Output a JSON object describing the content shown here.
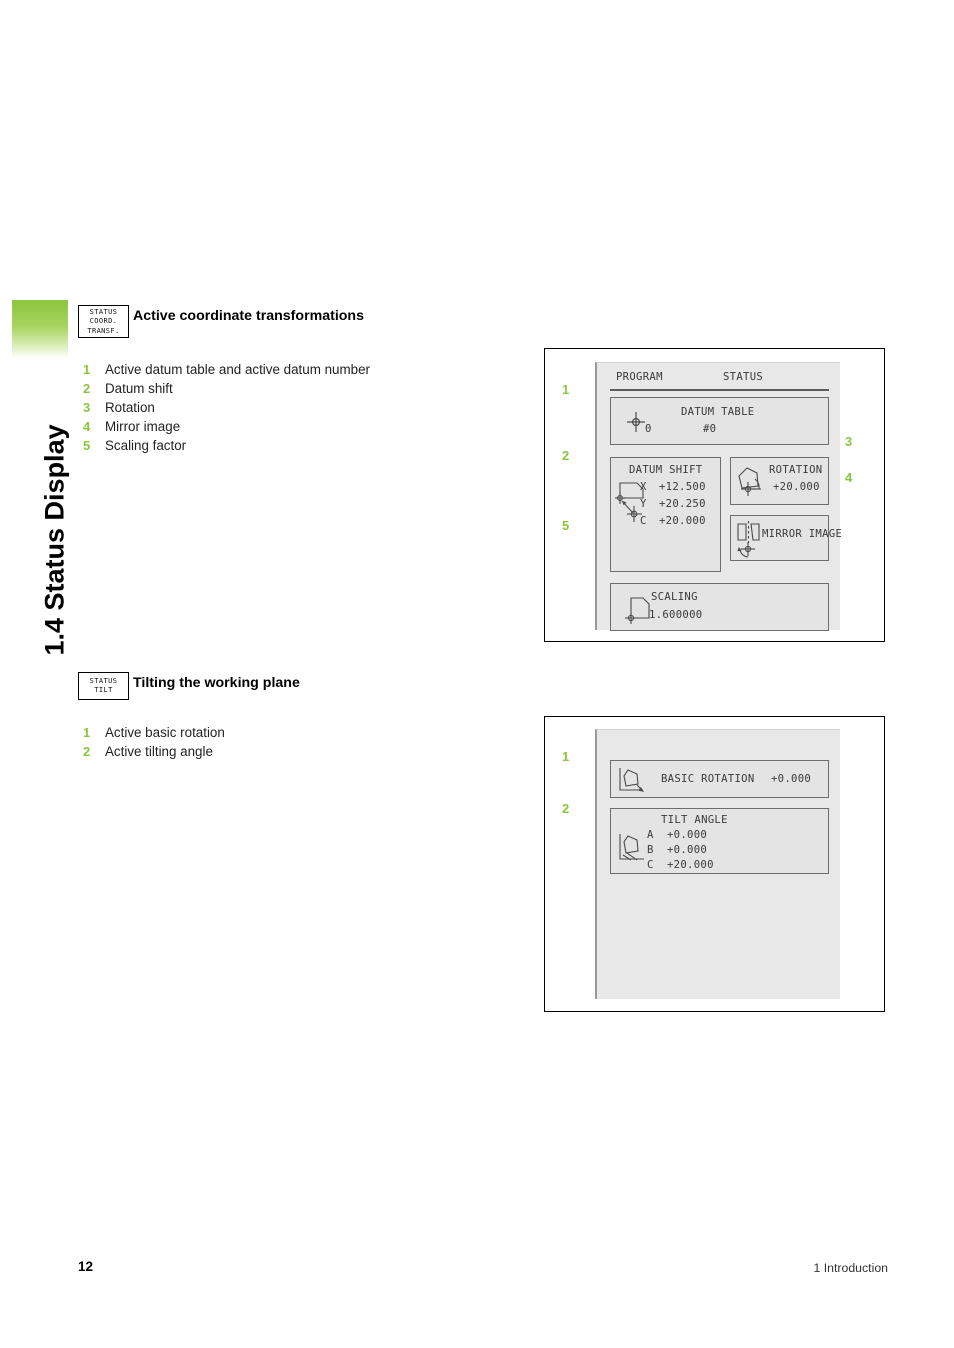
{
  "chapter": {
    "title": "1.4 Status Display",
    "accent_color": "#8CC63E"
  },
  "sections": [
    {
      "softkey": {
        "line1": "STATUS",
        "line2": "COORD.",
        "line3": "TRANSF."
      },
      "heading": "Active coordinate transformations",
      "legend": [
        {
          "num": "1",
          "label": "Active datum table and active datum number"
        },
        {
          "num": "2",
          "label": "Datum shift"
        },
        {
          "num": "3",
          "label": "Rotation"
        },
        {
          "num": "4",
          "label": "Mirror image"
        },
        {
          "num": "5",
          "label": "Scaling factor"
        }
      ]
    },
    {
      "softkey": {
        "line1": "STATUS",
        "line2": "TILT"
      },
      "heading": "Tilting the working plane",
      "legend": [
        {
          "num": "1",
          "label": "Active basic rotation"
        },
        {
          "num": "2",
          "label": "Active tilting angle"
        }
      ]
    }
  ],
  "figure1": {
    "callouts": {
      "c1": "1",
      "c2": "2",
      "c3": "3",
      "c4": "4",
      "c5": "5"
    },
    "topbar": {
      "program": "PROGRAM",
      "status": "STATUS"
    },
    "datum_table": {
      "title": "DATUM TABLE",
      "value1": "0",
      "value2": "#0"
    },
    "datum_shift": {
      "title": "DATUM SHIFT",
      "rows": [
        {
          "axis": "X",
          "value": "+12.500"
        },
        {
          "axis": "Y",
          "value": "+20.250"
        },
        {
          "axis": "C",
          "value": "+20.000"
        }
      ]
    },
    "rotation": {
      "title": "ROTATION",
      "value": "+20.000"
    },
    "mirror": {
      "title": "MIRROR IMAGE"
    },
    "scaling": {
      "title": "SCALING",
      "value": "1.600000"
    }
  },
  "figure2": {
    "callouts": {
      "c1": "1",
      "c2": "2"
    },
    "basic_rotation": {
      "title": "BASIC ROTATION",
      "value": "+0.000"
    },
    "tilt_angle": {
      "title": "TILT ANGLE",
      "rows": [
        {
          "axis": "A",
          "value": "+0.000"
        },
        {
          "axis": "B",
          "value": "+0.000"
        },
        {
          "axis": "C",
          "value": "+20.000"
        }
      ]
    }
  },
  "footer": {
    "page_number": "12",
    "chapter_label": "1 Introduction"
  }
}
